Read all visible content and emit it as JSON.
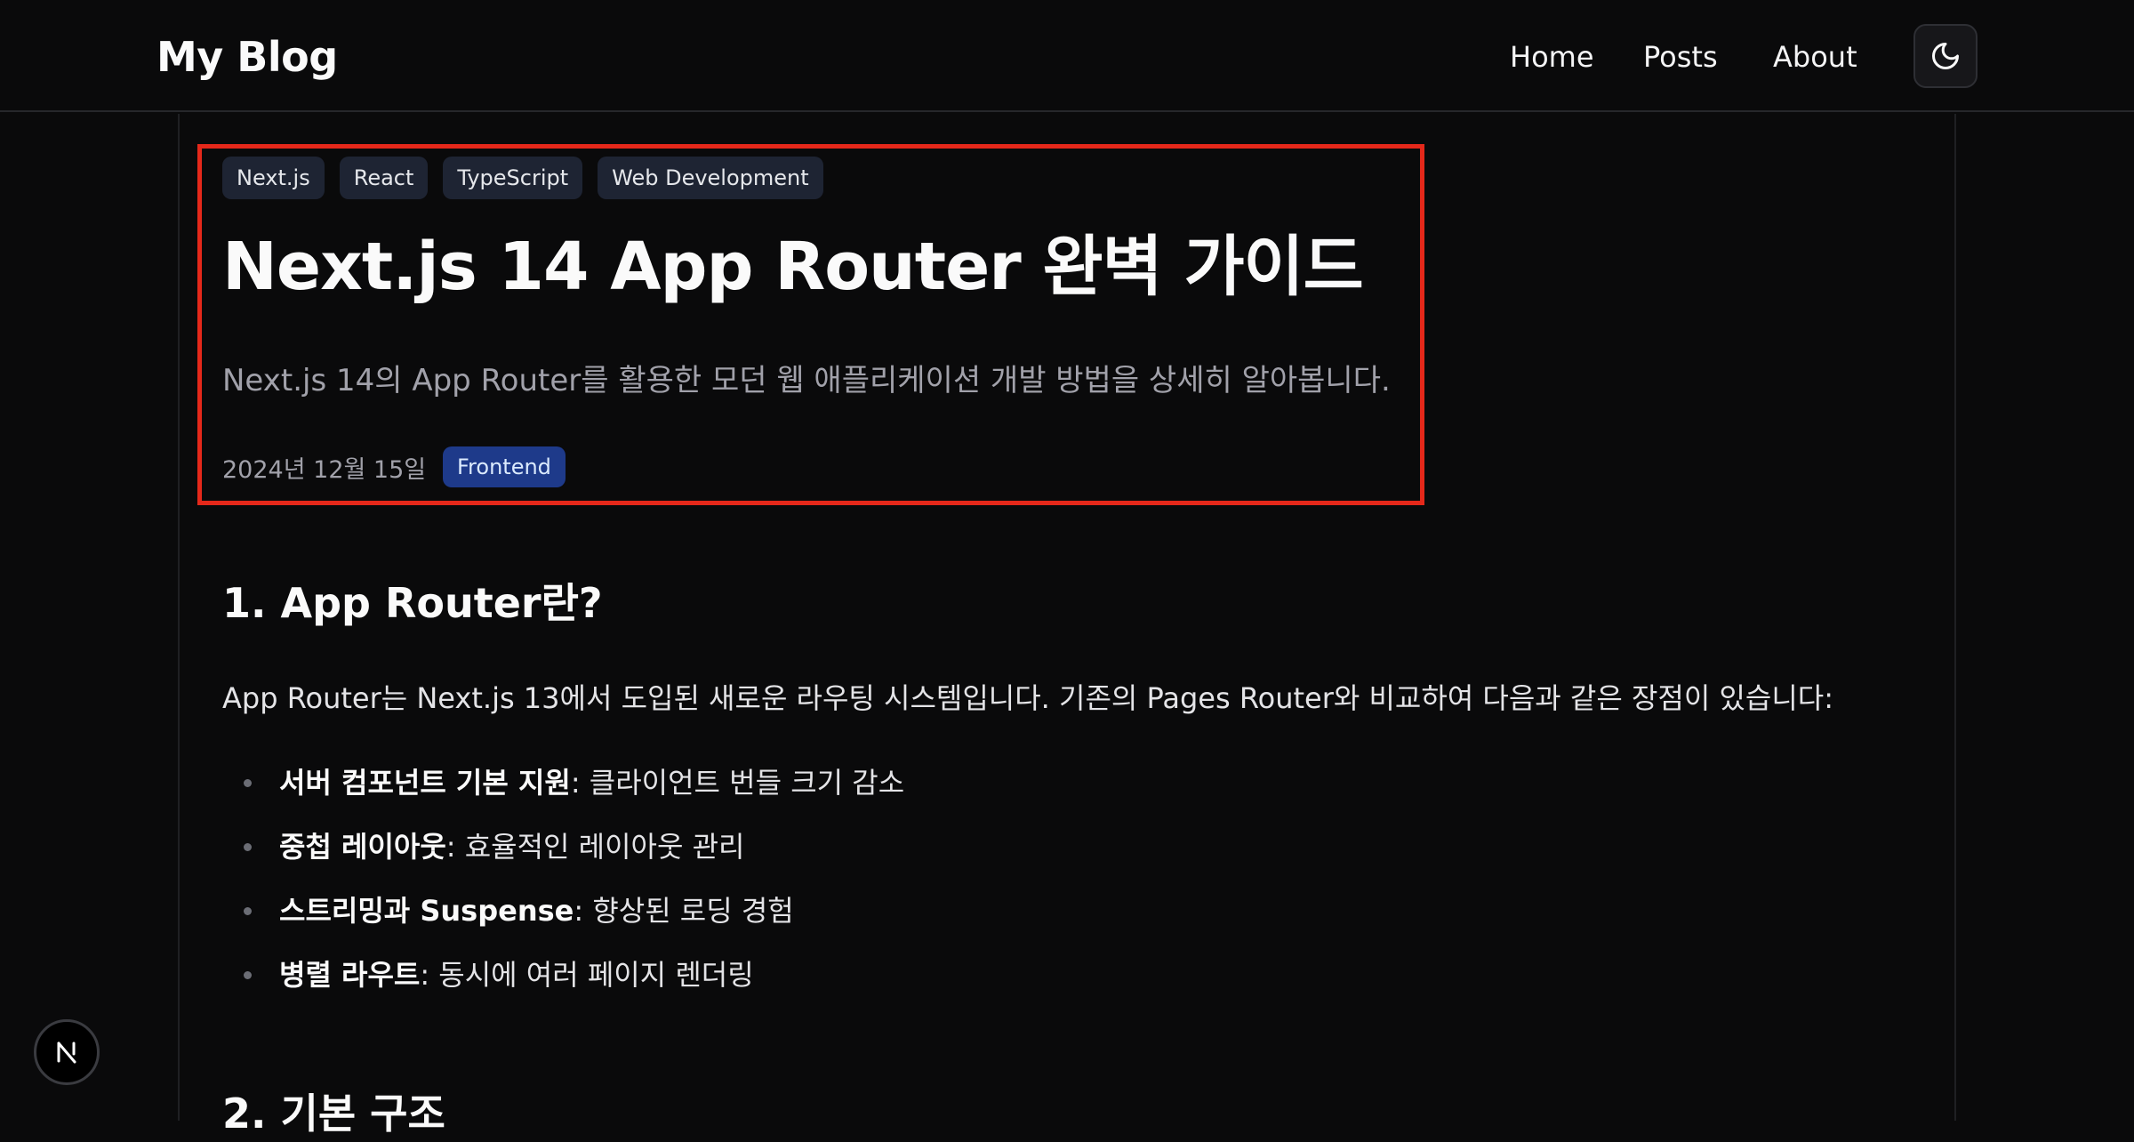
{
  "header": {
    "brand": "My Blog",
    "nav": [
      "Home",
      "Posts",
      "About"
    ],
    "theme_toggle_icon": "moon-icon"
  },
  "article": {
    "tags": [
      "Next.js",
      "React",
      "TypeScript",
      "Web Development"
    ],
    "title": "Next.js 14 App Router 완벽 가이드",
    "subtitle": "Next.js 14의 App Router를 활용한 모던 웹 애플리케이션 개발 방법을 상세히 알아봅니다.",
    "date": "2024년 12월 15일",
    "category": "Frontend"
  },
  "content": {
    "section1_heading": "1. App Router란?",
    "section1_paragraph": "App Router는 Next.js 13에서 도입된 새로운 라우팅 시스템입니다. 기존의 Pages Router와 비교하여 다음과 같은 장점이 있습니다:",
    "features": [
      {
        "term": "서버 컴포넌트 기본 지원",
        "desc": ": 클라이언트 번들 크기 감소"
      },
      {
        "term": "중첩 레이아웃",
        "desc": ": 효율적인 레이아웃 관리"
      },
      {
        "term": "스트리밍과 Suspense",
        "desc": ": 향상된 로딩 경험"
      },
      {
        "term": "병렬 라우트",
        "desc": ": 동시에 여러 페이지 렌더링"
      }
    ],
    "section2_heading": "2. 기본 구조"
  },
  "colors": {
    "background": "#0a0a0b",
    "highlight_border": "#e5281a",
    "category_badge": "#1e3a8a",
    "tag_badge": "#1e2433"
  },
  "dev_badge_icon": "nextjs-logo-icon"
}
